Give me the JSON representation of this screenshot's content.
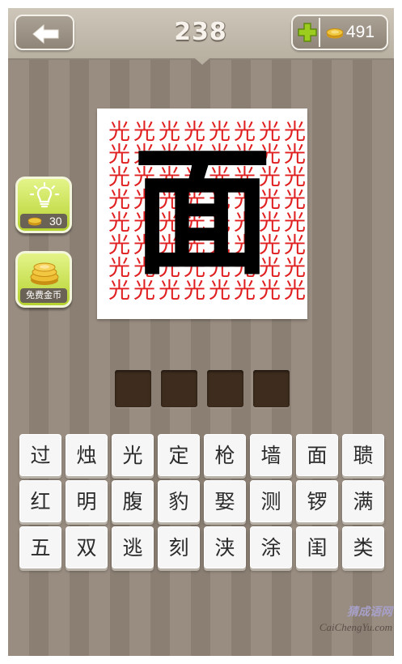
{
  "header": {
    "back_icon": "left-arrow-icon",
    "level": "238",
    "add_icon": "plus-icon",
    "coin_icon": "coin-stack-icon",
    "coins": "491"
  },
  "hint_button": {
    "icon": "lightbulb-icon",
    "price": "30"
  },
  "free_coins_button": {
    "icon": "coin-pile-icon",
    "label": "免费金币"
  },
  "puzzle": {
    "background_char": "光",
    "main_char": "面",
    "background_color": "#e02020",
    "main_color": "#000000"
  },
  "answer_slots": 4,
  "keyboard": {
    "rows": [
      [
        "过",
        "烛",
        "光",
        "定",
        "枪",
        "墙",
        "面",
        "聩"
      ],
      [
        "红",
        "明",
        "腹",
        "豹",
        "娶",
        "测",
        "锣",
        "满"
      ],
      [
        "五",
        "双",
        "逃",
        "刻",
        "浃",
        "涂",
        "闺",
        "类"
      ]
    ]
  },
  "watermark": {
    "cn": "猜成语网",
    "en": "CaiChengYu.com"
  },
  "colors": {
    "button_green": "#b5d22f",
    "slot_brown": "#3e2d1e",
    "stripe_dark": "#8b7f73",
    "stripe_light": "#998d81"
  }
}
